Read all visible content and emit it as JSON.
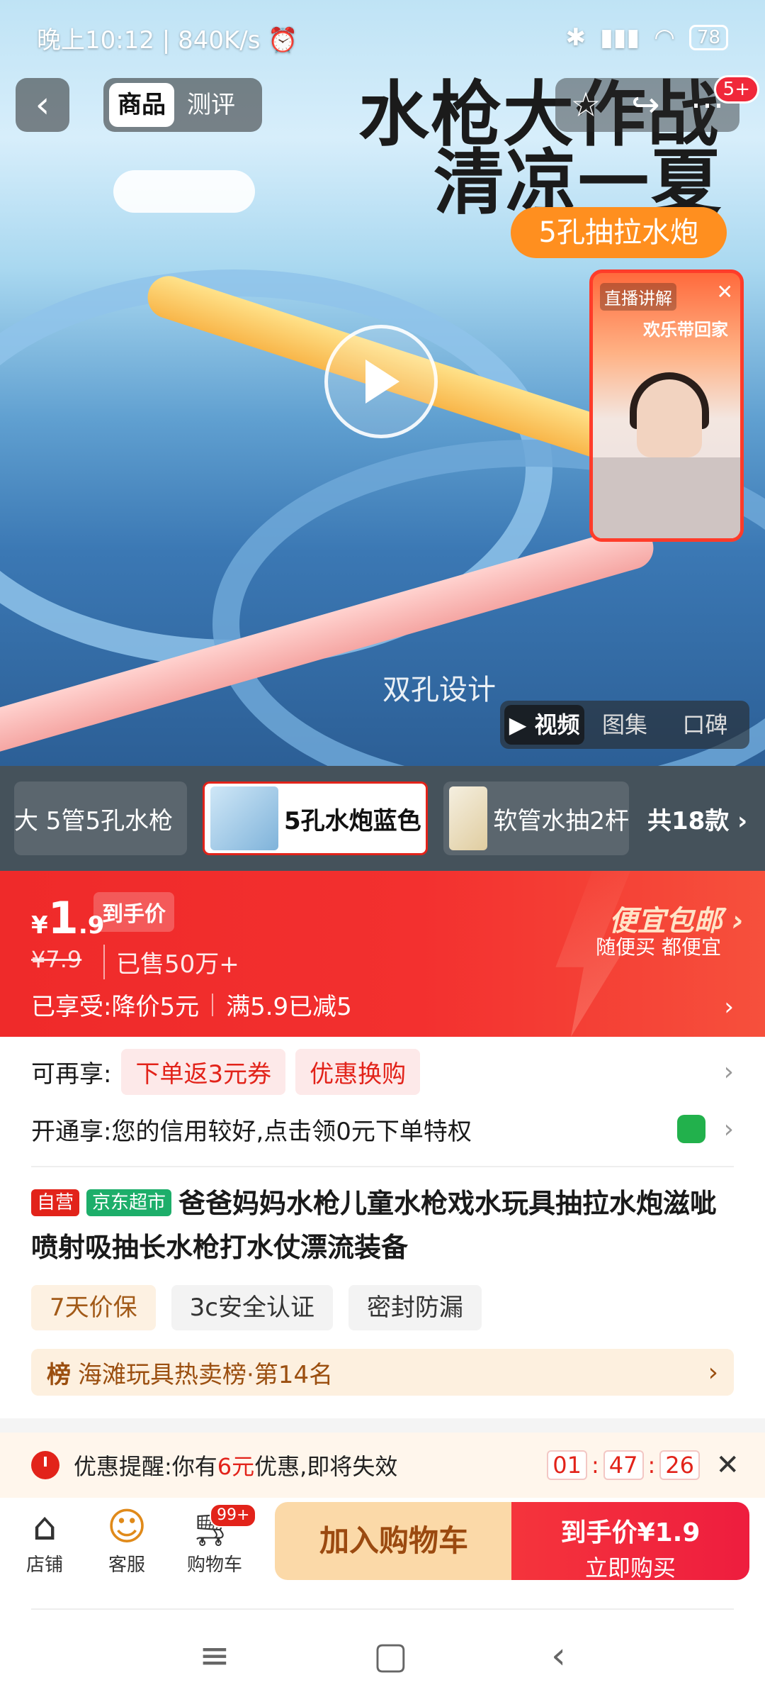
{
  "status_bar": {
    "time": "晚上10:12",
    "speed": "840K/s",
    "battery": "78"
  },
  "nav": {
    "back_icon": "back-arrow-icon",
    "tab_goods": "商品",
    "tab_review": "测评",
    "badge": "5+"
  },
  "hero": {
    "title_line1": "水枪大作战",
    "title_line2": "清凉一夏",
    "feature_pill": "5孔抽拉水炮",
    "watermark": "双孔设计",
    "live_label": "直播讲解",
    "live_banner": "欢乐带回家",
    "media_tabs": [
      "视频",
      "图集",
      "口碑"
    ]
  },
  "thumbs": {
    "items": [
      "大 5管5孔水枪",
      "5孔水炮蓝色",
      "软管水抽2杆"
    ],
    "count": "共18款"
  },
  "price": {
    "currency": "¥",
    "integer": "1",
    "decimal": ".9",
    "tag": "到手价",
    "old_price": "¥7.9",
    "sold": "已售50万+",
    "enjoy_label": "已享受:",
    "enjoy_1": "降价5元",
    "enjoy_2": "满5.9已减5",
    "promo_title": "便宜包邮",
    "promo_sub": "随便买 都便宜"
  },
  "offers": {
    "more_label": "可再享:",
    "coupon_1": "下单返3元券",
    "coupon_2": "优惠换购",
    "open_label": "开通享:",
    "open_text": "您的信用较好,点击领0元下单特权"
  },
  "product": {
    "tag_self": "自营",
    "tag_store": "京东超市",
    "title": "爸爸妈妈水枪儿童水枪戏水玩具抽拉水炮滋呲喷射吸抽长水枪打水仗漂流装备",
    "chips": [
      "7天价保",
      "3c安全认证",
      "密封防漏"
    ],
    "rank_icon": "榜",
    "rank_text": "海滩玩具热卖榜·第14名"
  },
  "reminder": {
    "prefix": "优惠提醒:你有",
    "amount": "6元",
    "suffix": "优惠,即将失效",
    "h": "01",
    "m": "47",
    "s": "26"
  },
  "bottom": {
    "store": "店铺",
    "service": "客服",
    "cart": "购物车",
    "cart_badge": "99+",
    "add_cart": "加入购物车",
    "buy_price": "到手价¥1.9",
    "buy_now": "立即购买"
  }
}
